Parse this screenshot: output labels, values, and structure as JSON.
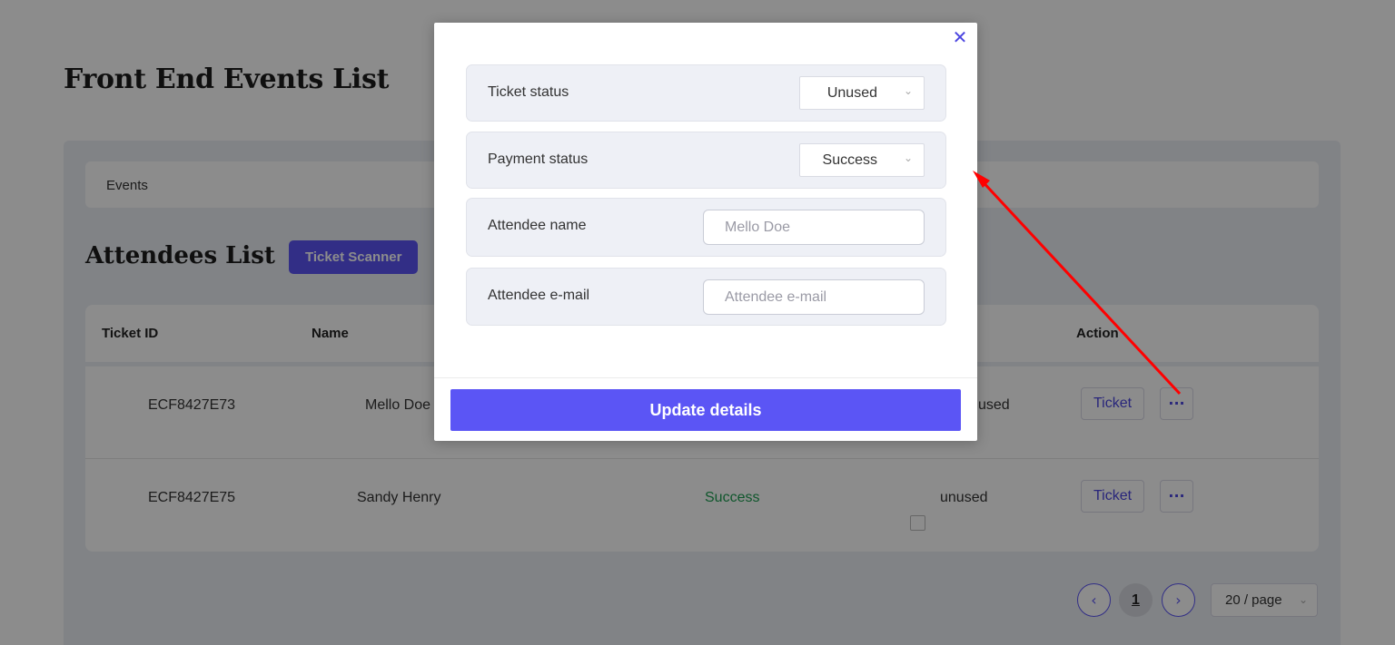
{
  "page": {
    "title": "Front End Events List",
    "breadcrumb": "Events",
    "section_title": "Attendees List",
    "ticket_scanner_label": "Ticket Scanner"
  },
  "table": {
    "headers": {
      "ticket_id": "Ticket ID",
      "name": "Name",
      "action": "Action"
    },
    "rows": [
      {
        "ticket_id": "ECF8427E73",
        "name": "Mello Doe",
        "payment": "",
        "status": "used",
        "ticket_label": "Ticket",
        "more_label": "···"
      },
      {
        "ticket_id": "ECF8427E75",
        "name": "Sandy Henry",
        "payment": "Success",
        "status": "unused",
        "ticket_label": "Ticket",
        "more_label": "···"
      }
    ]
  },
  "pagination": {
    "prev_icon": "chevron-left-icon",
    "next_icon": "chevron-right-icon",
    "current_page": "1",
    "page_size": "20 / page"
  },
  "modal": {
    "close_icon": "close-icon",
    "ticket_status": {
      "label": "Ticket status",
      "value": "Unused"
    },
    "payment_status": {
      "label": "Payment status",
      "value": "Success"
    },
    "attendee_name": {
      "label": "Attendee name",
      "placeholder": "Mello Doe",
      "value": ""
    },
    "attendee_email": {
      "label": "Attendee e-mail",
      "placeholder": "Attendee e-mail",
      "value": ""
    },
    "update_label": "Update details"
  },
  "colors": {
    "accent": "#5b55f5",
    "success": "#1e9e52",
    "annotation_arrow": "#ff0000"
  }
}
